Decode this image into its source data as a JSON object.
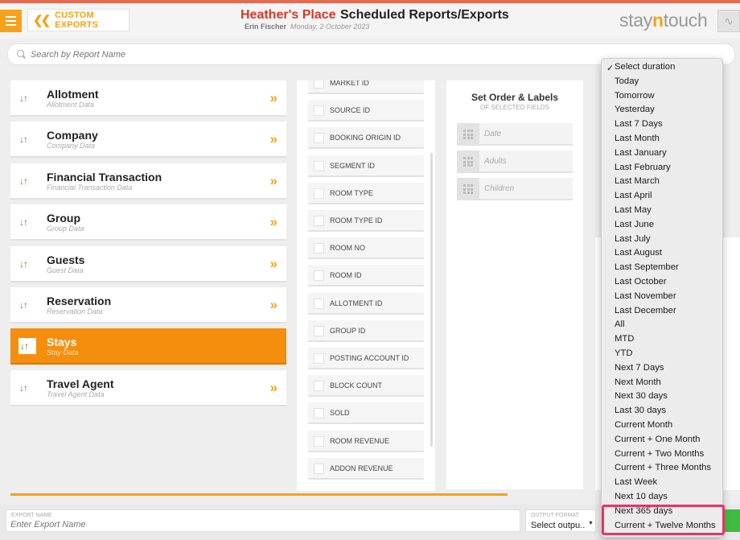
{
  "header": {
    "menu_label": "",
    "back_label": "CUSTOM EXPORTS",
    "hotel_name": "Heather's Place",
    "page_title": "Scheduled Reports/Exports",
    "user_name": "Erin Fischer",
    "date": "Monday, 2 October 2023",
    "logo_pre": "stay",
    "logo_mid": "n",
    "logo_post": "touch"
  },
  "search": {
    "placeholder": "Search by Report Name"
  },
  "reports": [
    {
      "title": "Allotment",
      "subtitle": "Allotment Data",
      "active": false
    },
    {
      "title": "Company",
      "subtitle": "Company Data",
      "active": false
    },
    {
      "title": "Financial Transaction",
      "subtitle": "Financial Transaction Data",
      "active": false
    },
    {
      "title": "Group",
      "subtitle": "Group Data",
      "active": false
    },
    {
      "title": "Guests",
      "subtitle": "Guest Data",
      "active": false
    },
    {
      "title": "Reservation",
      "subtitle": "Reservation Data",
      "active": false
    },
    {
      "title": "Stays",
      "subtitle": "Stay Data",
      "active": true
    },
    {
      "title": "Travel Agent",
      "subtitle": "Travel Agent Data",
      "active": false
    }
  ],
  "fields": [
    "MARKET ID",
    "SOURCE ID",
    "BOOKING ORIGIN ID",
    "SEGMENT ID",
    "ROOM TYPE",
    "ROOM TYPE ID",
    "ROOM NO",
    "ROOM ID",
    "ALLOTMENT ID",
    "GROUP ID",
    "POSTING ACCOUNT ID",
    "BLOCK COUNT",
    "SOLD",
    "ROOM REVENUE",
    "ADDON REVENUE"
  ],
  "order": {
    "title": "Set Order & Labels",
    "subtitle": "OF SELECTED FIELDS",
    "items": [
      "Date",
      "Adults",
      "Children"
    ]
  },
  "footer": {
    "export_name_caption": "EXPORT NAME",
    "export_name_placeholder": "Enter Export Name",
    "format_caption": "OUTPUT FORMAT",
    "format_value": "Select outpu.."
  },
  "duration_dropdown": {
    "selected": "Select duration",
    "options": [
      "Select duration",
      "Today",
      "Tomorrow",
      "Yesterday",
      "Last 7 Days",
      "Last Month",
      "Last January",
      "Last February",
      "Last March",
      "Last April",
      "Last May",
      "Last June",
      "Last July",
      "Last August",
      "Last September",
      "Last October",
      "Last November",
      "Last December",
      "All",
      "MTD",
      "YTD",
      "Next 7 Days",
      "Next Month",
      "Next 30 days",
      "Last 30 days",
      "Current Month",
      "Current + One Month",
      "Current + Two Months",
      "Current + Three Months",
      "Last Week",
      "Next 10 days",
      "Next 365 days",
      "Current + Twelve Months"
    ]
  },
  "colors": {
    "accent": "#f5a21b",
    "active_report": "#f58d0d",
    "hotel_name": "#d23a26",
    "highlight": "#e8336a"
  }
}
